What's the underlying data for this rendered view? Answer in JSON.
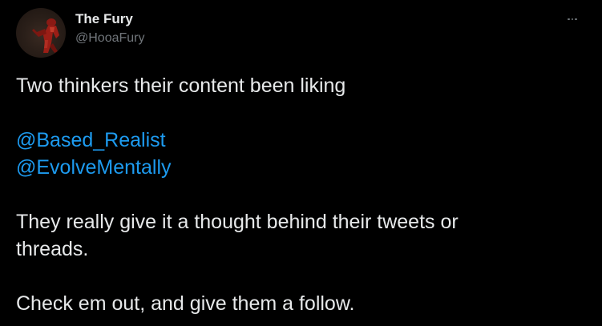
{
  "author": {
    "display_name": "The Fury",
    "handle": "@HooaFury"
  },
  "icons": {
    "more": "more-horizontal-icon",
    "avatar": "avatar-figure-image"
  },
  "tweet": {
    "line1": "Two thinkers their content been liking",
    "mentions": [
      "@Based_Realist",
      "@EvolveMentally"
    ],
    "line2a": "They really give it a thought behind their tweets or",
    "line2b": "threads.",
    "line3": "Check em out, and give them a follow."
  },
  "colors": {
    "background": "#000000",
    "text": "#e7e9ea",
    "muted": "#71767b",
    "link": "#1d9bf0"
  }
}
